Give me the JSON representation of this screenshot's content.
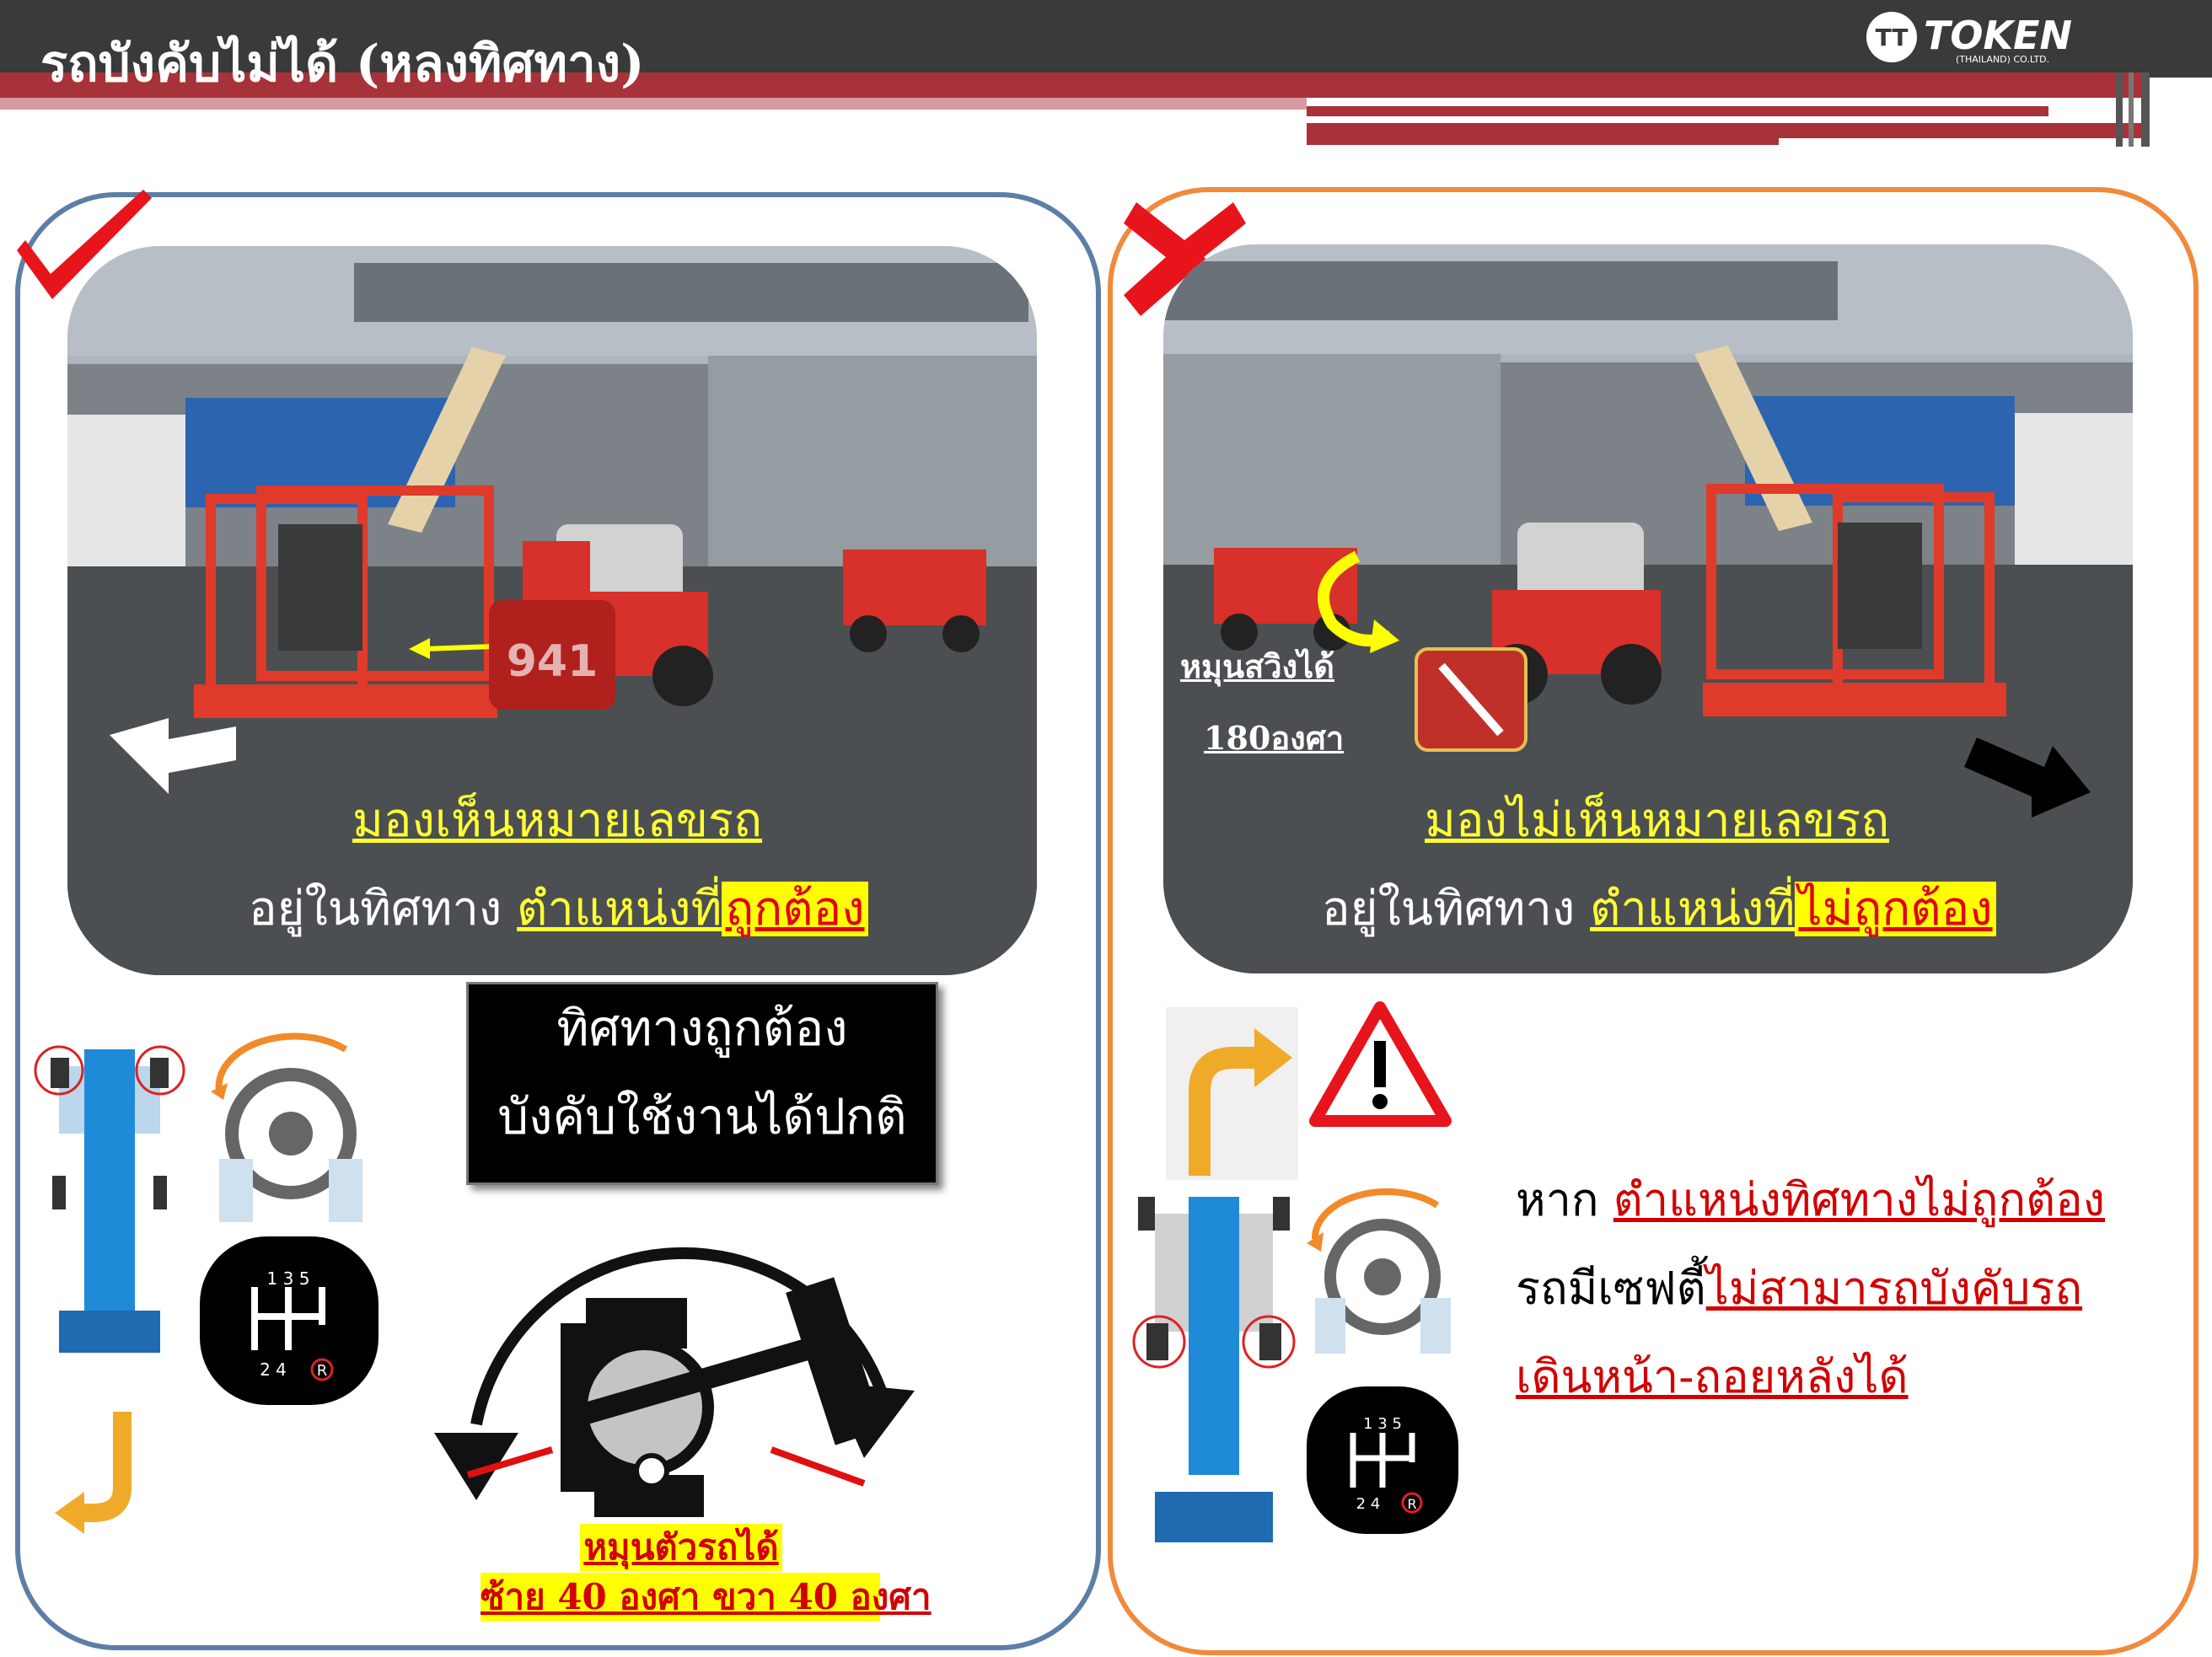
{
  "header": {
    "title": "รถบังคับไม่ได้ (หลงทิศทาง)",
    "logo_text": "TOKEN",
    "logo_sub": "(THAILAND) CO.LTD."
  },
  "left": {
    "photo_caption_1": "มองเห็นหมายเลขรถ",
    "line2_prefix": "อยู่ในทิศทาง ",
    "line2_pos": "ตำแหน่งที่",
    "line2_hl": "ถูกต้อง",
    "unit_number": "941",
    "box_line1": "ทิศทางถูกต้อง",
    "box_line2": "บังคับใช้งานได้ปกติ",
    "rotate_line1": "หมุนตัวรถได้",
    "rotate_line2": "ซ้าย 40 องศา ขวา 40 องศา",
    "gear_top": "1 3 5",
    "gear_bottom": "2 4"
  },
  "right": {
    "swing_line1": "หมุนสวิงได้",
    "swing_line2": "180องศา",
    "photo_caption_1": "มองไม่เห็นหมายเลขรถ",
    "line2_prefix": "อยู่ในทิศทาง ",
    "line2_pos": "ตำแหน่งที่",
    "line2_hl": "ไม่ถูกต้อง",
    "warn_prefix": "หาก ",
    "warn_1": "ตำแหน่งทิศทางไม่ถูกต้อง",
    "warn_2_prefix": "รถมีเซฟตี้",
    "warn_2": "ไม่สามารถบังคับรถ",
    "warn_3": "เดินหน้า-ถอยหลังได้",
    "gear_top": "1 3 5",
    "gear_bottom": "2 4"
  },
  "colors": {
    "check_red": "#e8141c",
    "left_border": "#5d7ea6",
    "right_border": "#f08a3c",
    "highlight": "#ffff00"
  }
}
